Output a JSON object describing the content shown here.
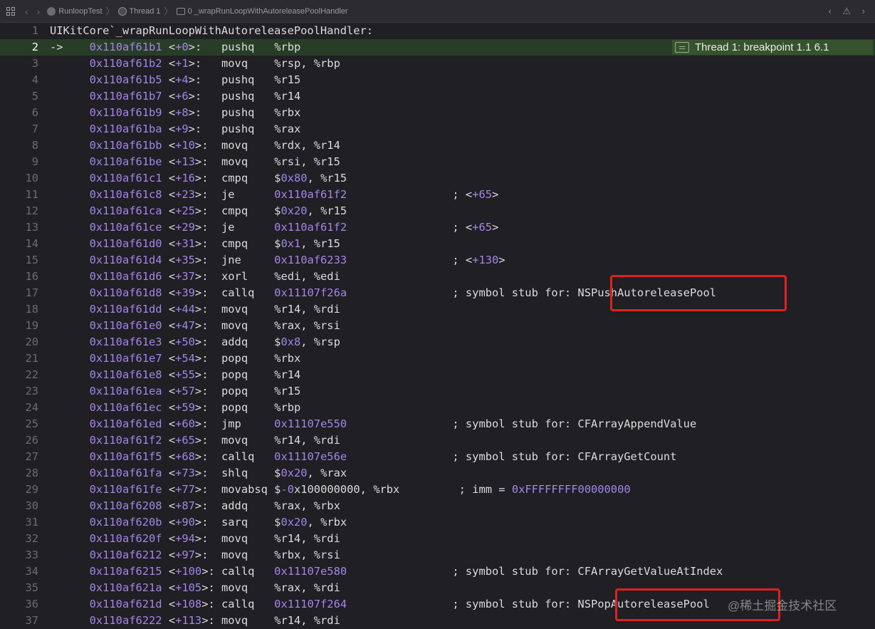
{
  "jumpbar": {
    "crumbs": [
      "RunloopTest",
      "Thread 1",
      "0 _wrapRunLoopWithAutoreleasePoolHandler"
    ],
    "nav_right": "‹ ⚠ ›"
  },
  "breakpoint_label": "Thread 1: breakpoint 1.1 6.1",
  "watermark": "@稀土掘金技术社区",
  "lines": [
    {
      "n": "1",
      "raw": "UIKitCore`_wrapRunLoopWithAutoreleasePoolHandler:"
    },
    {
      "n": "2",
      "marker": "->",
      "addr": "0x110af61b1",
      "off": "<+0>:  ",
      "op": "pushq",
      "args": "%rbp",
      "current": true
    },
    {
      "n": "3",
      "addr": "0x110af61b2",
      "off": "<+1>:  ",
      "op": "movq",
      "args": "%rsp, %rbp"
    },
    {
      "n": "4",
      "addr": "0x110af61b5",
      "off": "<+4>:  ",
      "op": "pushq",
      "args": "%r15"
    },
    {
      "n": "5",
      "addr": "0x110af61b7",
      "off": "<+6>:  ",
      "op": "pushq",
      "args": "%r14"
    },
    {
      "n": "6",
      "addr": "0x110af61b9",
      "off": "<+8>:  ",
      "op": "pushq",
      "args": "%rbx"
    },
    {
      "n": "7",
      "addr": "0x110af61ba",
      "off": "<+9>:  ",
      "op": "pushq",
      "args": "%rax"
    },
    {
      "n": "8",
      "addr": "0x110af61bb",
      "off": "<+10>: ",
      "op": "movq",
      "args": "%rdx, %r14"
    },
    {
      "n": "9",
      "addr": "0x110af61be",
      "off": "<+13>: ",
      "op": "movq",
      "args": "%rsi, %r15"
    },
    {
      "n": "10",
      "addr": "0x110af61c1",
      "off": "<+16>: ",
      "op": "cmpq",
      "args": "$0x80, %r15"
    },
    {
      "n": "11",
      "addr": "0x110af61c8",
      "off": "<+23>: ",
      "op": "je",
      "args": "0x110af61f2",
      "target": true,
      "comment": "<+65>"
    },
    {
      "n": "12",
      "addr": "0x110af61ca",
      "off": "<+25>: ",
      "op": "cmpq",
      "args": "$0x20, %r15"
    },
    {
      "n": "13",
      "addr": "0x110af61ce",
      "off": "<+29>: ",
      "op": "je",
      "args": "0x110af61f2",
      "target": true,
      "comment": "<+65>"
    },
    {
      "n": "14",
      "addr": "0x110af61d0",
      "off": "<+31>: ",
      "op": "cmpq",
      "args": "$0x1, %r15"
    },
    {
      "n": "15",
      "addr": "0x110af61d4",
      "off": "<+35>: ",
      "op": "jne",
      "args": "0x110af6233",
      "target": true,
      "comment": "<+130>"
    },
    {
      "n": "16",
      "addr": "0x110af61d6",
      "off": "<+37>: ",
      "op": "xorl",
      "args": "%edi, %edi"
    },
    {
      "n": "17",
      "addr": "0x110af61d8",
      "off": "<+39>: ",
      "op": "callq",
      "args": "0x11107f26a",
      "target": true,
      "comment": "symbol stub for: NSPushAutoreleasePool"
    },
    {
      "n": "18",
      "addr": "0x110af61dd",
      "off": "<+44>: ",
      "op": "movq",
      "args": "%r14, %rdi"
    },
    {
      "n": "19",
      "addr": "0x110af61e0",
      "off": "<+47>: ",
      "op": "movq",
      "args": "%rax, %rsi"
    },
    {
      "n": "20",
      "addr": "0x110af61e3",
      "off": "<+50>: ",
      "op": "addq",
      "args": "$0x8, %rsp"
    },
    {
      "n": "21",
      "addr": "0x110af61e7",
      "off": "<+54>: ",
      "op": "popq",
      "args": "%rbx"
    },
    {
      "n": "22",
      "addr": "0x110af61e8",
      "off": "<+55>: ",
      "op": "popq",
      "args": "%r14"
    },
    {
      "n": "23",
      "addr": "0x110af61ea",
      "off": "<+57>: ",
      "op": "popq",
      "args": "%r15"
    },
    {
      "n": "24",
      "addr": "0x110af61ec",
      "off": "<+59>: ",
      "op": "popq",
      "args": "%rbp"
    },
    {
      "n": "25",
      "addr": "0x110af61ed",
      "off": "<+60>: ",
      "op": "jmp",
      "args": "0x11107e550",
      "target": true,
      "comment": "symbol stub for: CFArrayAppendValue"
    },
    {
      "n": "26",
      "addr": "0x110af61f2",
      "off": "<+65>: ",
      "op": "movq",
      "args": "%r14, %rdi"
    },
    {
      "n": "27",
      "addr": "0x110af61f5",
      "off": "<+68>: ",
      "op": "callq",
      "args": "0x11107e56e",
      "target": true,
      "comment": "symbol stub for: CFArrayGetCount"
    },
    {
      "n": "28",
      "addr": "0x110af61fa",
      "off": "<+73>: ",
      "op": "shlq",
      "args": "$0x20, %rax"
    },
    {
      "n": "29",
      "addr": "0x110af61fe",
      "off": "<+77>: ",
      "op": "movabsq",
      "args": "$-0x100000000, %rbx",
      "comment": "imm = 0xFFFFFFFF00000000",
      "wide": true
    },
    {
      "n": "30",
      "addr": "0x110af6208",
      "off": "<+87>: ",
      "op": "addq",
      "args": "%rax, %rbx"
    },
    {
      "n": "31",
      "addr": "0x110af620b",
      "off": "<+90>: ",
      "op": "sarq",
      "args": "$0x20, %rbx"
    },
    {
      "n": "32",
      "addr": "0x110af620f",
      "off": "<+94>: ",
      "op": "movq",
      "args": "%r14, %rdi"
    },
    {
      "n": "33",
      "addr": "0x110af6212",
      "off": "<+97>: ",
      "op": "movq",
      "args": "%rbx, %rsi"
    },
    {
      "n": "34",
      "addr": "0x110af6215",
      "off": "<+100>:",
      "op": "callq",
      "args": "0x11107e580",
      "target": true,
      "comment": "symbol stub for: CFArrayGetValueAtIndex"
    },
    {
      "n": "35",
      "addr": "0x110af621a",
      "off": "<+105>:",
      "op": "movq",
      "args": "%rax, %rdi"
    },
    {
      "n": "36",
      "addr": "0x110af621d",
      "off": "<+108>:",
      "op": "callq",
      "args": "0x11107f264",
      "target": true,
      "comment": "symbol stub for: NSPopAutoreleasePool"
    },
    {
      "n": "37",
      "addr": "0x110af6222",
      "off": "<+113>:",
      "op": "movq",
      "args": "%r14, %rdi"
    }
  ]
}
